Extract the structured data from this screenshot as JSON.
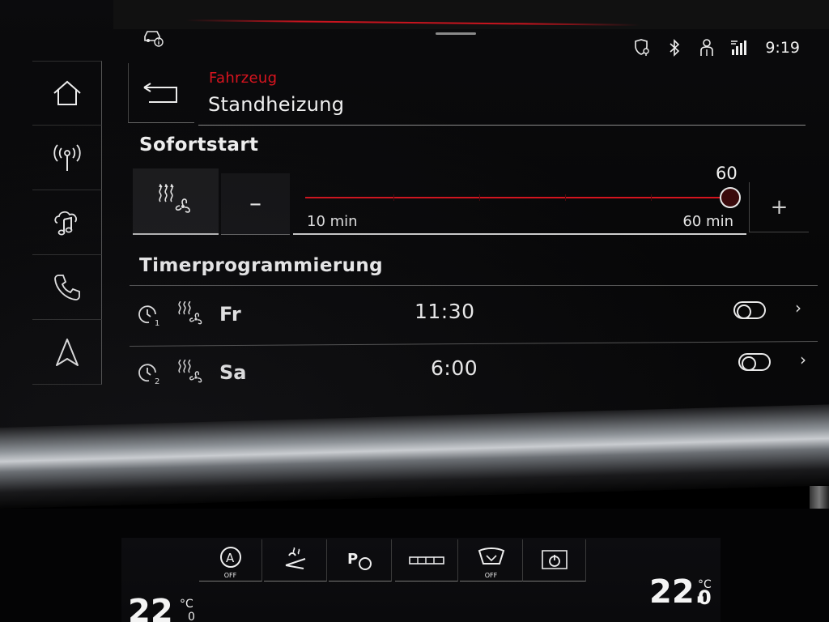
{
  "status_bar": {
    "icons": [
      "location-shield-icon",
      "bluetooth-icon",
      "person-icon",
      "network-icon"
    ],
    "time": "9:19"
  },
  "top_left_icon": "car-info-icon",
  "sidebar": {
    "items": [
      {
        "name": "home",
        "icon": "home-icon"
      },
      {
        "name": "radio",
        "icon": "radio-antenna-icon"
      },
      {
        "name": "media",
        "icon": "music-cloud-icon"
      },
      {
        "name": "phone",
        "icon": "phone-icon"
      },
      {
        "name": "navigation",
        "icon": "navigation-arrow-icon"
      }
    ]
  },
  "header": {
    "breadcrumb": "Fahrzeug",
    "title": "Standheizung",
    "back_icon": "back-arrow-icon"
  },
  "sofortstart": {
    "title": "Sofortstart",
    "mode_icon": "heater-fan-icon",
    "minus_label": "–",
    "plus_label": "+",
    "slider": {
      "value": "60",
      "min_label": "10 min",
      "max_label": "60 min",
      "level": 1.0
    }
  },
  "timer": {
    "title": "Timerprogrammierung",
    "rows": [
      {
        "icon": "timer-1-icon",
        "mode_icon": "heater-fan-icon",
        "day": "Fr",
        "time": "11:30",
        "enabled": false
      },
      {
        "icon": "timer-2-icon",
        "mode_icon": "heater-fan-icon",
        "day": "Sa",
        "time": "6:00",
        "enabled": false
      }
    ],
    "chevron": "›"
  },
  "climate": {
    "buttons": [
      {
        "icon": "auto-off-icon",
        "label": "OFF"
      },
      {
        "icon": "seat-heating-icon",
        "label": ""
      },
      {
        "icon": "parking-heater-icon",
        "label": "P"
      },
      {
        "icon": "air-distribution-icon",
        "label": ""
      },
      {
        "icon": "windshield-off-icon",
        "label": "OFF"
      },
      {
        "icon": "power-icon",
        "label": ""
      }
    ],
    "left_temp": "22",
    "left_unit": "°C",
    "left_decimal": "0",
    "right_temp": "22.",
    "right_unit": "°C",
    "right_decimal": "0"
  },
  "colors": {
    "accent_red": "#d4141e",
    "text": "#f2f2f2",
    "background": "#08080a"
  }
}
